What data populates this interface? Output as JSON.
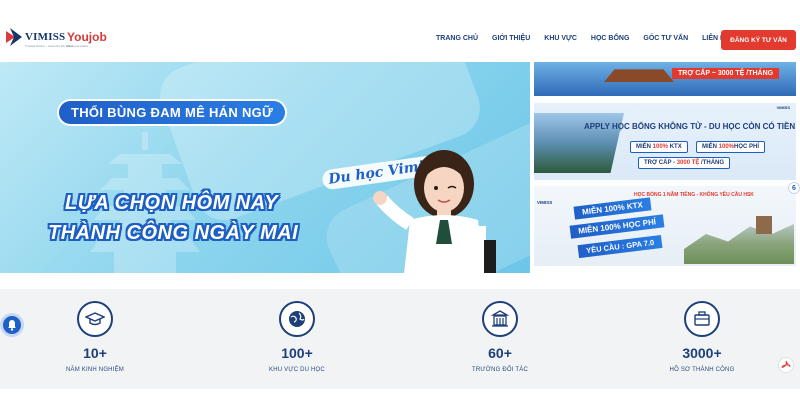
{
  "header": {
    "logo_vimiss": {
      "word": "VIMISS",
      "tagline": "Trusted choice – Learn for the future"
    },
    "logo_youjob": {
      "word": "Youjob",
      "tagline": "Find your future"
    },
    "nav": [
      "TRANG CHỦ",
      "GIỚI THIỆU",
      "KHU VỰC",
      "HỌC BỔNG",
      "GÓC TƯ VẤN",
      "LIÊN HỆ"
    ],
    "cta_label": "ĐĂNG KÝ TƯ VẤN"
  },
  "hero": {
    "pill": "THỔI BÙNG ĐAM MÊ HÁN NGỮ",
    "line1": "LỰA CHỌN HÔM NAY",
    "line2": "THÀNH CÔNG NGÀY MAI",
    "script": "Du học Vimiss"
  },
  "cards": {
    "card1": {
      "tag": "TRỢ CẤP ~ 3000 TỆ /THÁNG"
    },
    "card2": {
      "brand": "VIMISS",
      "title": "APPLY HỌC BỔNG KHÔNG TỬ - DU HỌC CÒN CÓ TIỀN",
      "chip1_a": "MIỄN ",
      "chip1_b": "100%",
      "chip1_c": " KTX",
      "chip2_a": "MIỄN ",
      "chip2_b": "100%",
      "chip2_c": "HỌC PHÍ",
      "chip3_a": "TRỢ CẤP - ",
      "chip3_b": "3000 TỆ",
      "chip3_c": " /THÁNG"
    },
    "card3": {
      "brand": "VIMISS",
      "top": "HỌC BỔNG 1 NĂM TIẾNG - KHÔNG YÊU CẦU HSK",
      "b1": "MIỄN 100% KTX",
      "b2": "MIỄN 100% HỌC PHÍ",
      "b3": "YÊU CẦU : GPA 7.0"
    },
    "badge": "6"
  },
  "stats": [
    {
      "icon": "graduation-cap-icon",
      "value": "10+",
      "label": "NĂM KINH NGHIỆM"
    },
    {
      "icon": "globe-icon",
      "value": "100+",
      "label": "KHU VỰC DU HỌC"
    },
    {
      "icon": "school-building-icon",
      "value": "60+",
      "label": "TRƯỜNG ĐỐI TÁC"
    },
    {
      "icon": "briefcase-icon",
      "value": "3000+",
      "label": "HỒ SƠ THÀNH CÔNG"
    }
  ],
  "colors": {
    "brand_navy": "#1d3f7a",
    "cta_red": "#e23a2f",
    "hero_sky": "#8fd6ee",
    "stats_bg": "#f2f3f5"
  }
}
